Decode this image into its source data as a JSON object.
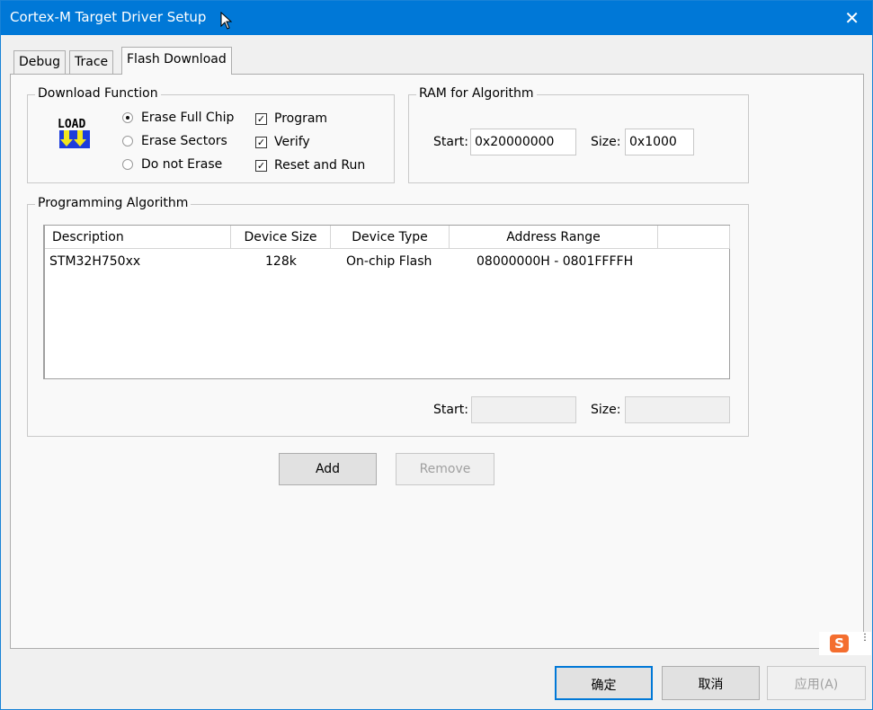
{
  "window": {
    "title": "Cortex-M Target Driver Setup",
    "close_glyph": "✕"
  },
  "tabs": [
    {
      "label": "Debug"
    },
    {
      "label": "Trace"
    },
    {
      "label": "Flash Download"
    }
  ],
  "download_function": {
    "legend": "Download Function",
    "radios": [
      {
        "label": "Erase Full Chip",
        "checked": true
      },
      {
        "label": "Erase Sectors",
        "checked": false
      },
      {
        "label": "Do not Erase",
        "checked": false
      }
    ],
    "checks": [
      {
        "label": "Program",
        "checked": true
      },
      {
        "label": "Verify",
        "checked": true
      },
      {
        "label": "Reset and Run",
        "checked": true
      }
    ],
    "icon_text": "LOAD"
  },
  "ram": {
    "legend": "RAM for Algorithm",
    "start_label": "Start:",
    "start_value": "0x20000000",
    "size_label": "Size:",
    "size_value": "0x1000"
  },
  "algorithm": {
    "legend": "Programming Algorithm",
    "columns": [
      "Description",
      "Device Size",
      "Device Type",
      "Address Range"
    ],
    "rows": [
      {
        "description": "STM32H750xx",
        "size": "128k",
        "type": "On-chip Flash",
        "range": "08000000H - 0801FFFFH"
      }
    ],
    "start_label": "Start:",
    "size_label": "Size:",
    "start_value": "",
    "size_value": ""
  },
  "buttons": {
    "add": "Add",
    "remove": "Remove",
    "ok": "确定",
    "cancel": "取消",
    "apply": "应用(A)"
  },
  "ime": {
    "logo": "S",
    "more_glyph": "⋮"
  },
  "colors": {
    "titlebar": "#0078d7",
    "ime_logo": "#f46e2f"
  }
}
